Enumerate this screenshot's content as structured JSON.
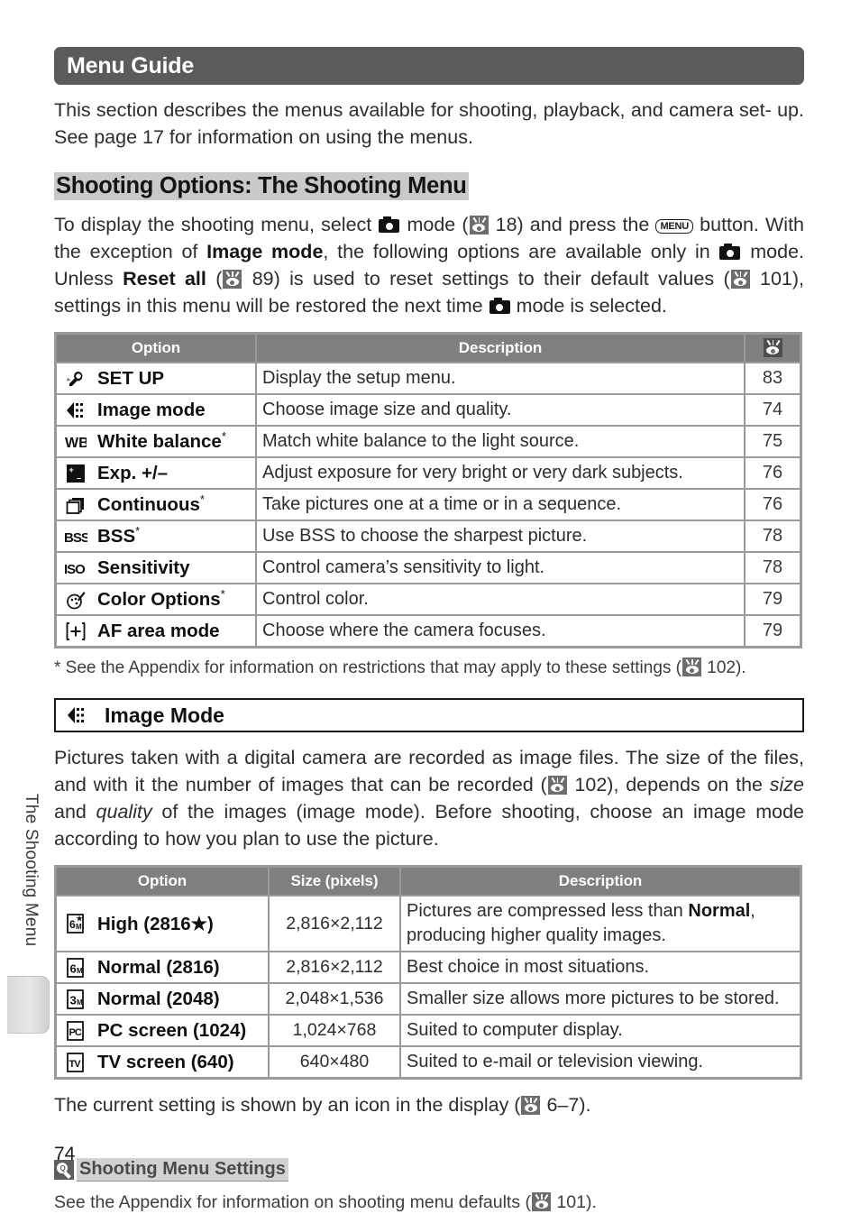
{
  "chapter": {
    "banner_title": "Menu Guide",
    "side_tab_label": "The Shooting Menu",
    "page_number": "74"
  },
  "intro": {
    "line1": "This section describes the menus available for shooting, playback, and camera set-",
    "line2": "up.  See page 17 for information on using the menus."
  },
  "section": {
    "heading": "Shooting Options: The Shooting Menu",
    "para": {
      "t1": "To display the shooting menu, select ",
      "t2": " mode (",
      "t3": " 18) and press the ",
      "t4": " button. With the exception of ",
      "b1": "Image mode",
      "t5": ", the following options are available only in ",
      "t6": " mode.  Unless ",
      "b2": "Reset all",
      "t7": " (",
      "t8": " 89) is used to reset settings to their default values (",
      "t9": " 101), settings in this menu will be restored the next time ",
      "t10": " mode is selected.",
      "page_ref_18": "18",
      "page_ref_89": "89",
      "page_ref_101": "101",
      "menu_button_label": "MENU"
    }
  },
  "menu_table": {
    "headers": {
      "option": "Option",
      "description": "Description",
      "page": "page-reference-icon"
    },
    "rows": [
      {
        "icon": "wrench-icon",
        "option": "SET UP",
        "star": false,
        "description": "Display the setup menu.",
        "page": "83"
      },
      {
        "icon": "image-mode-icon",
        "option": "Image mode",
        "star": false,
        "description": "Choose image size and quality.",
        "page": "74"
      },
      {
        "icon": "white-balance-icon",
        "option": "White balance",
        "star": true,
        "description": "Match white balance to the light source.",
        "page": "75"
      },
      {
        "icon": "exposure-comp-icon",
        "option": "Exp. +/–",
        "star": false,
        "description": "Adjust exposure for very bright or very dark subjects.",
        "page": "76"
      },
      {
        "icon": "continuous-icon",
        "option": "Continuous",
        "star": true,
        "description": "Take pictures one at a time or in a sequence.",
        "page": "76"
      },
      {
        "icon": "bss-icon",
        "option": "BSS",
        "star": true,
        "description": "Use BSS to choose the sharpest picture.",
        "page": "78"
      },
      {
        "icon": "iso-icon",
        "option": "Sensitivity",
        "star": false,
        "description": "Control camera’s sensitivity to light.",
        "page": "78"
      },
      {
        "icon": "color-options-icon",
        "option": "Color Options",
        "star": true,
        "description": "Control color.",
        "page": "79"
      },
      {
        "icon": "af-area-icon",
        "option": "AF area mode",
        "star": false,
        "description": "Choose where the camera focuses.",
        "page": "79"
      }
    ],
    "footnote": {
      "t1": "* See the Appendix for information on restrictions that may apply to these settings (",
      "t2": " 102).",
      "page_ref": "102"
    }
  },
  "image_mode": {
    "boxed_heading": "Image Mode",
    "boxed_icon": "image-mode-icon",
    "para": {
      "t1": "Pictures taken with a digital camera are recorded as image files.  The size of the files, and with it the number of images that can be recorded (",
      "t2": " 102), depends on the ",
      "i1": "size",
      "t3": " and ",
      "i2": "quality",
      "t4": " of the images (image mode).  Before shooting, choose an image mode according to how you plan to use the picture.",
      "page_ref": "102"
    },
    "table": {
      "headers": {
        "option": "Option",
        "size": "Size (pixels)",
        "description": "Description"
      },
      "rows": [
        {
          "icon": "high-6m-icon",
          "option": "High (2816★)",
          "size": "2,816×2,112",
          "description_pre": "Pictures are compressed less than ",
          "description_bold": "Normal",
          "description_post": ", producing higher quality images."
        },
        {
          "icon": "normal-6m-icon",
          "option": "Normal (2816)",
          "size": "2,816×2,112",
          "description_pre": "Best choice in most situations.",
          "description_bold": "",
          "description_post": ""
        },
        {
          "icon": "normal-3m-icon",
          "option": "Normal (2048)",
          "size": "2,048×1,536",
          "description_pre": "Smaller size allows more pictures to be stored.",
          "description_bold": "",
          "description_post": ""
        },
        {
          "icon": "pc-screen-icon",
          "option": "PC screen (1024)",
          "size": "1,024×768",
          "description_pre": "Suited to computer display.",
          "description_bold": "",
          "description_post": ""
        },
        {
          "icon": "tv-screen-icon",
          "option": "TV screen (640)",
          "size": "640×480",
          "description_pre": "Suited to e-mail or television viewing.",
          "description_bold": "",
          "description_post": ""
        }
      ]
    },
    "closing": {
      "t1": "The current setting is shown by an icon in the display (",
      "t2": " 6–7).",
      "page_ref": "6–7"
    }
  },
  "tip": {
    "icon": "magnifier-tip-icon",
    "heading": "Shooting Menu Settings",
    "body_t1": "See the Appendix for information on shooting menu defaults (",
    "body_t2": " 101).",
    "page_ref": "101"
  },
  "colors": {
    "banner_bg": "#5b5b5b",
    "table_header_bg": "#7f7f7f",
    "table_border": "#9a9a9a",
    "heading_highlight": "#c9c9c9",
    "tip_highlight": "#d2d2d2"
  }
}
